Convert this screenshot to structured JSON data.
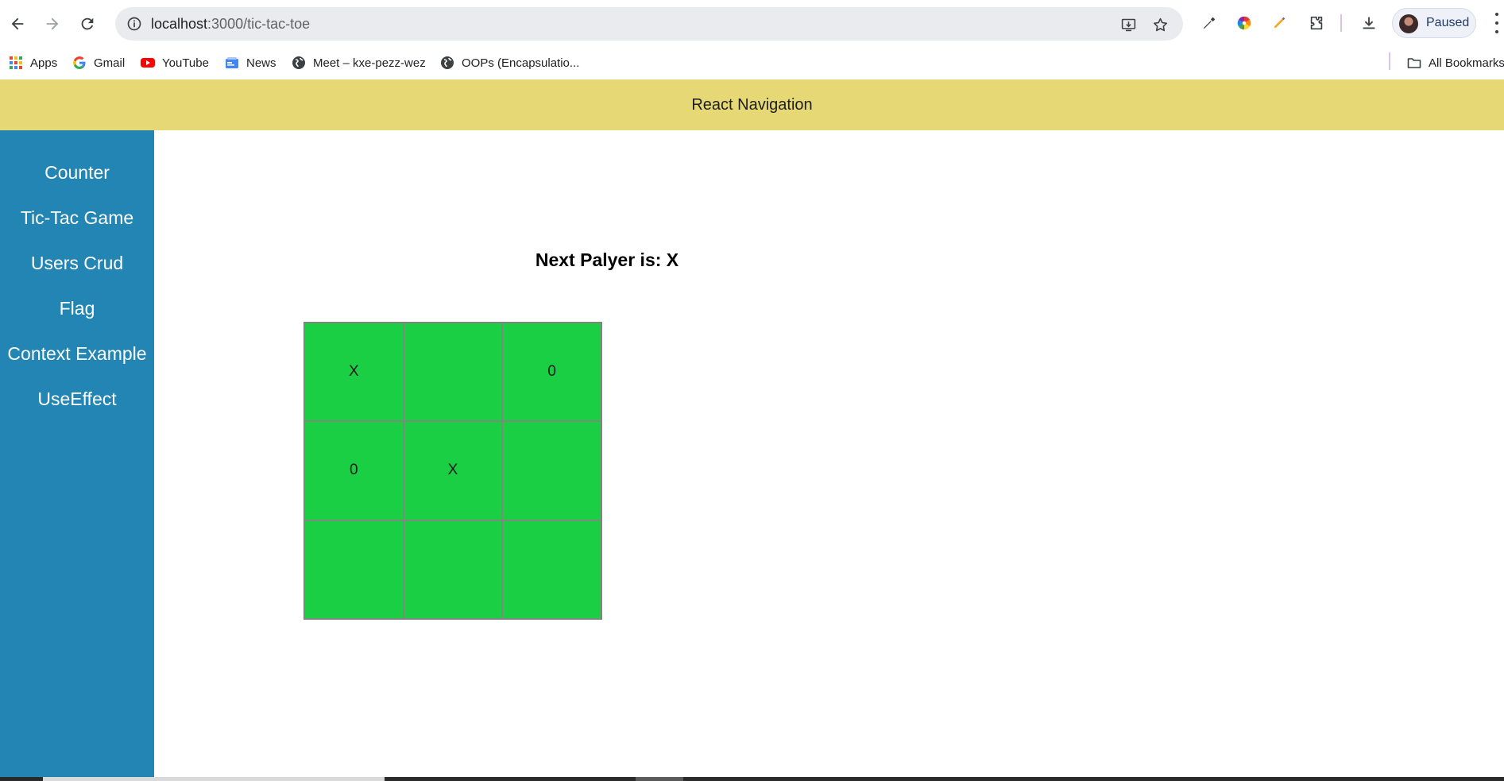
{
  "browser": {
    "url_host": "localhost",
    "url_path": ":3000/tic-tac-toe",
    "profile_label": "Paused",
    "icons": [
      "back-icon",
      "forward-icon",
      "reload-icon",
      "site-info-icon",
      "install-app-icon",
      "bookmark-star-icon",
      "eyedropper-icon",
      "color-wheel-icon",
      "pen-icon",
      "extensions-icon",
      "downloads-icon",
      "menu-icon"
    ]
  },
  "bookmarks": {
    "items": [
      {
        "label": "Apps",
        "icon": "apps-grid-icon"
      },
      {
        "label": "Gmail",
        "icon": "google-icon"
      },
      {
        "label": "YouTube",
        "icon": "youtube-icon"
      },
      {
        "label": "News",
        "icon": "news-icon"
      },
      {
        "label": "Meet – kxe-pezz-wez",
        "icon": "globe-icon"
      },
      {
        "label": "OOPs (Encapsulatio...",
        "icon": "globe-icon"
      }
    ],
    "all_bookmarks": "All Bookmarks"
  },
  "app": {
    "header_title": "React Navigation",
    "colors": {
      "header": "#e6d975",
      "sidebar": "#2285b3",
      "board": "#1bcf44"
    },
    "nav": [
      {
        "label": "Counter"
      },
      {
        "label": "Tic-Tac Game"
      },
      {
        "label": "Users Crud"
      },
      {
        "label": "Flag"
      },
      {
        "label": "Context Example"
      },
      {
        "label": "UseEffect"
      }
    ],
    "game": {
      "status": "Next Palyer is: X",
      "board": [
        "X",
        "",
        "0",
        "0",
        "X",
        "",
        "",
        "",
        ""
      ]
    }
  }
}
